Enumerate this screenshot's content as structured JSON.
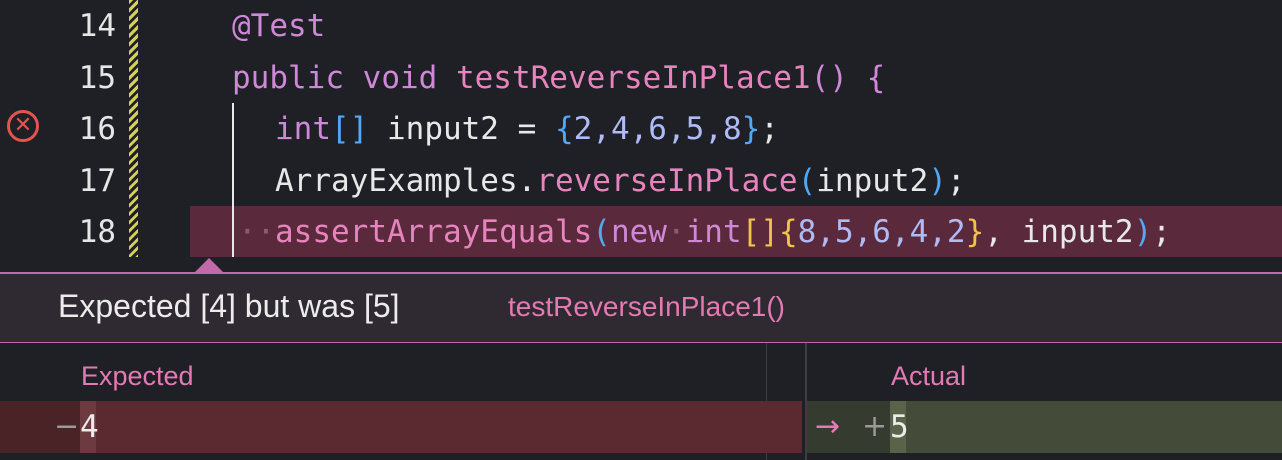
{
  "editor": {
    "lines": [
      {
        "number": "14"
      },
      {
        "number": "15"
      },
      {
        "number": "16"
      },
      {
        "number": "17"
      },
      {
        "number": "18"
      }
    ],
    "code": {
      "l14_annotation": "@Test",
      "l15_public": "public",
      "l15_void": "void",
      "l15_name": "testReverseInPlace1",
      "l15_parens": "()",
      "l15_brace": "{",
      "l16_int": "int",
      "l16_brackets": "[]",
      "l16_var": " input2 = ",
      "l16_open": "{",
      "l16_nums": "2,4,6,5,8",
      "l16_close": "}",
      "l16_semi": ";",
      "l17_class": "ArrayExamples.",
      "l17_method": "reverseInPlace",
      "l17_open": "(",
      "l17_arg": "input2",
      "l17_close": ")",
      "l17_semi": ";",
      "l18_method": "assertArrayEquals",
      "l18_open": "(",
      "l18_new": "new",
      "l18_int": "int",
      "l18_brackets": "[]",
      "l18_bopen": "{",
      "l18_nums": "8,5,6,4,2",
      "l18_bclose": "}",
      "l18_comma": ", ",
      "l18_arg": "input2",
      "l18_close": ")",
      "l18_semi": ";"
    },
    "colors": {
      "keyword": "#ce88d7",
      "function": "#e884bd",
      "bracket": "#53a8f5",
      "error_highlight": "#5a2a3c"
    }
  },
  "message": {
    "text": "Expected [4] but was [5]",
    "test_name": "testReverseInPlace1()"
  },
  "diff": {
    "expected_header": "Expected",
    "actual_header": "Actual",
    "expected_minus": "−",
    "expected_value": "4",
    "actual_arrow": "→",
    "actual_plus": "+",
    "actual_value": "5"
  }
}
